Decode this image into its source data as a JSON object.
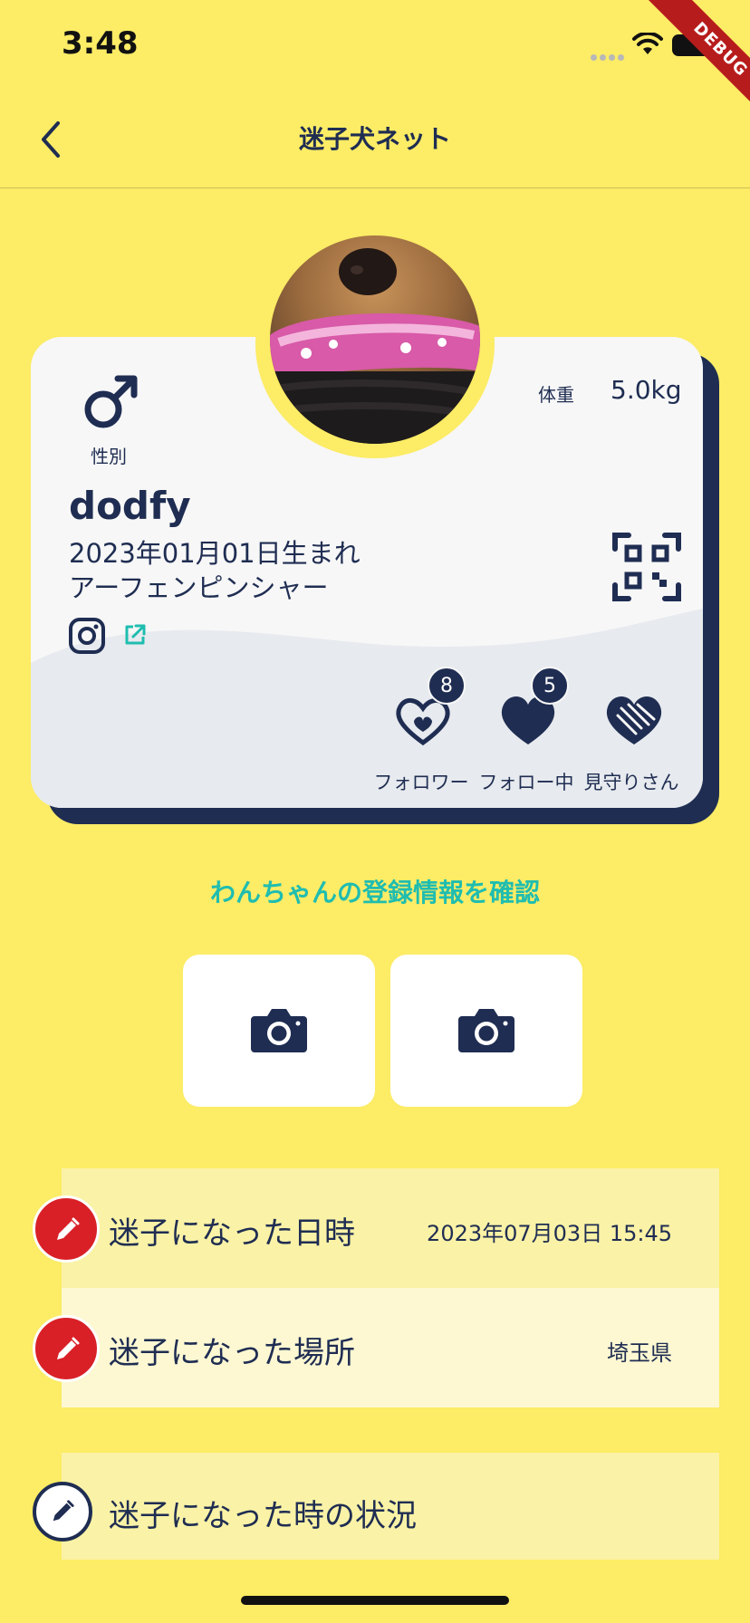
{
  "status_bar": {
    "time": "3:48",
    "debug_label": "DEBUG"
  },
  "nav": {
    "title": "迷子犬ネット",
    "back_icon": "chevron-left-icon"
  },
  "pet": {
    "gender_label": "性別",
    "gender_icon": "male-icon",
    "weight_label": "体重",
    "weight_value": "5.0kg",
    "name": "dodfy",
    "birth": "2023年01月01日生まれ",
    "breed": "アーフェンピンシャー"
  },
  "stats": {
    "followers": {
      "label": "フォロワー",
      "count": "8",
      "icon": "hands-heart-icon"
    },
    "following": {
      "label": "フォロー中",
      "count": "5",
      "icon": "heart-icon"
    },
    "watchers": {
      "label": "見守りさん",
      "icon": "handshake-heart-icon"
    }
  },
  "register_link": "わんちゃんの登録情報を確認",
  "photos": [
    {
      "icon": "camera-icon"
    },
    {
      "icon": "camera-icon"
    }
  ],
  "lost_info": {
    "datetime_label": "迷子になった日時",
    "datetime_value": "2023年07月03日 15:45",
    "place_label": "迷子になった場所",
    "place_value": "埼玉県",
    "situation_label": "迷子になった時の状況"
  },
  "colors": {
    "background": "#FCEC66",
    "navy": "#1F2D52",
    "accent_teal": "#1FBDB0",
    "edit_red": "#D92027"
  }
}
